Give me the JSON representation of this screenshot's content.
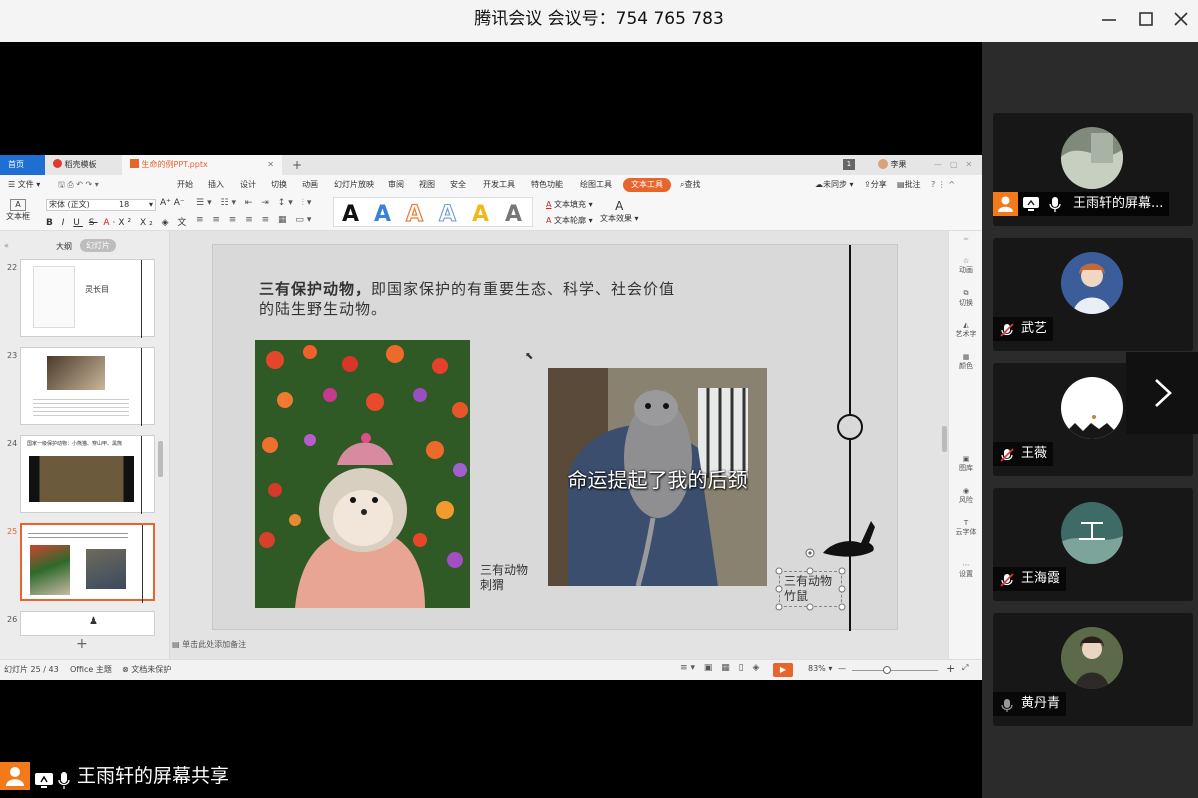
{
  "meeting": {
    "title": "腾讯会议 会议号：754 765 783"
  },
  "participants": [
    {
      "name": "王雨轩的屏幕...",
      "mic": "on"
    },
    {
      "name": "武艺",
      "mic": "muted"
    },
    {
      "name": "王薇",
      "mic": "muted"
    },
    {
      "name": "王海霞",
      "mic": "muted"
    },
    {
      "name": "黄丹青",
      "mic": "on"
    }
  ],
  "share_caption": "王雨轩的屏幕共享",
  "ppt": {
    "tabs": [
      "首页",
      "稻壳模板",
      "生命的例PPT.pptx"
    ],
    "user": "李果",
    "page_count_badge": "1",
    "menu": [
      "文件",
      "开始",
      "插入",
      "设计",
      "切换",
      "动画",
      "幻灯片放映",
      "审阅",
      "视图",
      "安全",
      "开发工具",
      "特色功能",
      "绘图工具",
      "文本工具",
      "查找"
    ],
    "menu_right": [
      "未同步",
      "分享",
      "批注"
    ],
    "font_name": "宋体 (正文)",
    "font_size": "18",
    "style_label": "文本框",
    "text_fill": "文本填充",
    "text_outline": "文本轮廓",
    "text_effect": "文本效果",
    "outline_tabs": [
      "大纲",
      "幻灯片"
    ],
    "thumbs": [
      {
        "num": "22",
        "title": "灵长目"
      },
      {
        "num": "23"
      },
      {
        "num": "24",
        "caption": "国家一级保护动物：小熊猫、穿山甲、黑熊"
      },
      {
        "num": "25"
      },
      {
        "num": "26"
      }
    ],
    "slide": {
      "heading_bold": "三有保护动物，",
      "heading_rest": "即国家保护的有重要生态、科学、社会价值",
      "heading_line2": "的陆生野生动物。",
      "img1_label_1": "三有动物",
      "img1_label_2": "刺猬",
      "meme_text": "命运提起了我的后颈",
      "img2_label_1": "三有动物",
      "img2_label_2": "竹鼠"
    },
    "side_tools": [
      "动画",
      "切换",
      "艺术字",
      "颜色",
      "图库",
      "风险",
      "云字体",
      "设置"
    ],
    "notes_hint": "单击此处添加备注",
    "status": {
      "slide_info": "幻灯片 25 / 43",
      "theme": "Office 主题",
      "protection": "文档未保护",
      "zoom": "83%"
    }
  },
  "colors": {
    "accent": "#e8642d",
    "tab_blue": "#1f6fd2",
    "meeting_bg": "#000000",
    "panel_bg": "#2b2b2b",
    "orange": "#f27a1a"
  }
}
